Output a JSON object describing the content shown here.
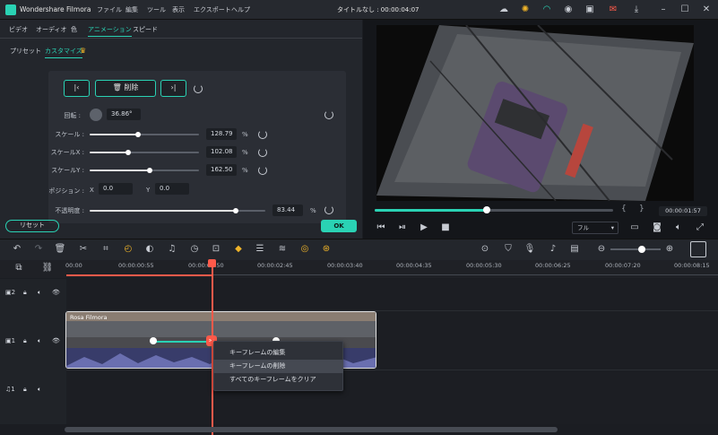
{
  "app": {
    "name": "Wondershare Filmora",
    "window_title": "タイトルなし : 00:00:04:07"
  },
  "menu": [
    "ファイル",
    "編集",
    "ツール",
    "表示",
    "エクスポート",
    "ヘルプ"
  ],
  "tabs": [
    "ビデオ",
    "オーディオ",
    "色",
    "アニメーション",
    "スピード"
  ],
  "active_tab": "アニメーション",
  "subtabs": {
    "preset": "プリセット",
    "custom": "カスタマイズ"
  },
  "keyframe": {
    "delete_label": "削除"
  },
  "properties": [
    {
      "label": "回転 :",
      "value": "36.86°"
    },
    {
      "label": "スケール :",
      "value": "128.79",
      "unit": "%",
      "fraction": 0.44
    },
    {
      "label": "スケールX :",
      "value": "102.08",
      "unit": "%",
      "fraction": 0.35
    },
    {
      "label": "スケールY :",
      "value": "162.50",
      "unit": "%",
      "fraction": 0.55
    },
    {
      "label": "ポジション :",
      "x_label": "X",
      "x": "0.0",
      "y_label": "Y",
      "y": "0.0"
    },
    {
      "label": "不透明度 :",
      "value": "83.44",
      "unit": "%",
      "fraction": 0.83
    }
  ],
  "buttons": {
    "reset": "リセット",
    "ok": "OK"
  },
  "player": {
    "progress": 0.47,
    "timecode": "00:00:01:57",
    "quality": "フル"
  },
  "ruler_ticks": [
    "00:00",
    "00:00:00:55",
    "00:00:01:50",
    "00:00:02:45",
    "00:00:03:40",
    "00:00:04:35",
    "00:00:05:30",
    "00:00:06:25",
    "00:00:07:20",
    "00:00:08:15"
  ],
  "tracks": {
    "v2": "2",
    "v1": "1",
    "a1": "1"
  },
  "clip": {
    "name": "Rosa Filmora"
  },
  "context_menu": [
    "キーフレームの編集",
    "キーフレームの削除",
    "すべてのキーフレームをクリア"
  ],
  "colors": {
    "accent": "#2ad2b4",
    "playhead": "#ff5a4a"
  }
}
